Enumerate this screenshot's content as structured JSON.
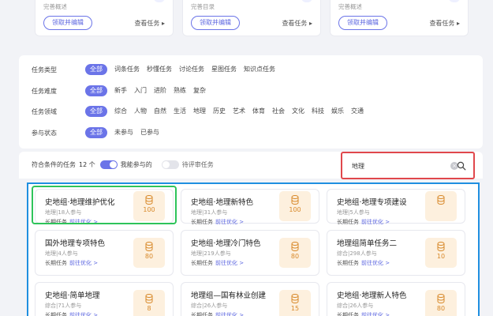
{
  "top_cards": [
    {
      "desc": "完善概述",
      "claim": "领取并编辑",
      "view": "查看任务 ▸"
    },
    {
      "desc": "完善目录",
      "claim": "领取并编辑",
      "view": "查看任务 ▸"
    },
    {
      "desc": "完善概述",
      "claim": "领取并编辑",
      "view": "查看任务 ▸"
    }
  ],
  "filters": {
    "type": {
      "label": "任务类型",
      "options": [
        "全部",
        "词条任务",
        "秒懂任务",
        "讨论任务",
        "星图任务",
        "知识点任务"
      ],
      "active": 0
    },
    "difficulty": {
      "label": "任务难度",
      "options": [
        "全部",
        "新手",
        "入门",
        "进阶",
        "熟练",
        "复杂"
      ],
      "active": 0
    },
    "field": {
      "label": "任务领域",
      "options": [
        "全部",
        "综合",
        "人物",
        "自然",
        "生活",
        "地理",
        "历史",
        "艺术",
        "体育",
        "社会",
        "文化",
        "科技",
        "娱乐",
        "交通"
      ],
      "active": 0
    },
    "status": {
      "label": "参与状态",
      "options": [
        "全部",
        "未参与",
        "已参与"
      ],
      "active": 0
    }
  },
  "results": {
    "count_label": "符合条件的任务",
    "count": "12 个",
    "toggle_joinable": {
      "label": "我能参与的",
      "on": true
    },
    "toggle_pending": {
      "label": "待评审任务",
      "on": false
    }
  },
  "search": {
    "value": "地理",
    "clear": "×"
  },
  "tasks": [
    {
      "title": "史地组·地理维护优化",
      "meta": "地理|18人参与",
      "type": "长期任务",
      "go": "前往优化 >",
      "reward": "100"
    },
    {
      "title": "史地组·地理新特色",
      "meta": "地理|31人参与",
      "type": "长期任务",
      "go": "前往优化 >",
      "reward": "100"
    },
    {
      "title": "史地组·地理专项建设",
      "meta": "地理|5人参与",
      "type": "长期任务",
      "go": "前往优化 >",
      "reward": ""
    },
    {
      "title": "国外地理专项特色",
      "meta": "地理|4人参与",
      "type": "长期任务",
      "go": "前往优化 >",
      "reward": "80"
    },
    {
      "title": "史地组·地理冷门特色",
      "meta": "地理|219人参与",
      "type": "长期任务",
      "go": "前往优化 >",
      "reward": "80"
    },
    {
      "title": "地理组简单任务二",
      "meta": "综合|298人参与",
      "type": "长期任务",
      "go": "前往优化 >",
      "reward": "10"
    },
    {
      "title": "史地组·简单地理",
      "meta": "综合|71人参与",
      "type": "长期任务",
      "go": "前往优化 >",
      "reward": "8"
    },
    {
      "title": "地理组—国有林业创建",
      "meta": "综合|26人参与",
      "type": "长期任务",
      "go": "前往优化 >",
      "reward": "15"
    },
    {
      "title": "史地组·地理新人特色",
      "meta": "综合|26人参与",
      "type": "长期任务",
      "go": "前往优化 >",
      "reward": "80"
    }
  ],
  "colors": {
    "accent": "#6b74e8",
    "search_highlight": "#e0474c",
    "grid_highlight": "#1f8fe0",
    "card_highlight": "#2ec45a",
    "reward_bg": "#fdf0de",
    "reward_text": "#d8892a"
  },
  "icons": {
    "search": "search-icon",
    "clear": "clear-icon",
    "coin": "coin-icon"
  }
}
